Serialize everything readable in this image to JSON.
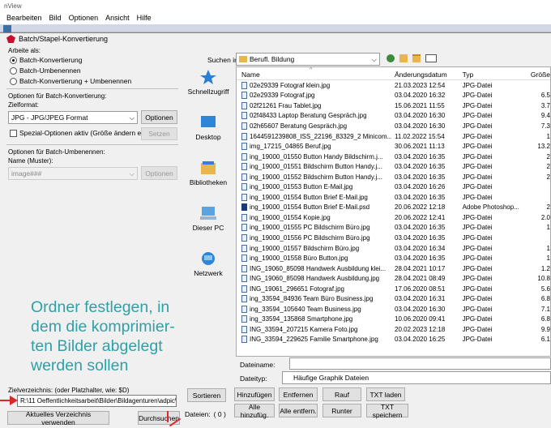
{
  "app": {
    "title": "nView",
    "menu": [
      "Bearbeiten",
      "Bild",
      "Optionen",
      "Ansicht",
      "Hilfe"
    ]
  },
  "dialog": {
    "title": "Batch/Stapel-Konvertierung",
    "mode": {
      "label": "Arbeite als:",
      "options": [
        "Batch-Konvertierung",
        "Batch-Umbenennen",
        "Batch-Konvertierung + Umbenennen"
      ],
      "selected": "Batch-Konvertierung"
    },
    "convert_options": {
      "label": "Optionen für Batch-Konvertierung:",
      "format_label": "Zielformat:",
      "format_value": "JPG - JPG/JPEG Format",
      "options_button": "Optionen",
      "special_checkbox": "Spezial-Optionen aktiv (Größe ändern etc.)",
      "set_button": "Setzen"
    },
    "rename_options": {
      "label": "Optionen für Batch-Umbenennen:",
      "name_label": "Name (Muster):",
      "name_value": "image###",
      "options_button": "Optionen"
    },
    "target": {
      "label": "Zielverzeichnis: (oder Platzhalter, wie: $D)",
      "path": "R:\\11 Oeffentlichkeitsarbeit\\Bilder\\Bildagenturen\\adpic\\Ben...",
      "use_current_button": "Aktuelles Verzeichnis verwenden",
      "browse_button": "Durchsuchen"
    },
    "browser": {
      "search_label": "Suchen in:",
      "folder": "Berufl. Bildung",
      "places": [
        "Schnellzugriff",
        "Desktop",
        "Bibliotheken",
        "Dieser PC",
        "Netzwerk"
      ],
      "columns": [
        "Name",
        "Änderungsdatum",
        "Typ",
        "Größe"
      ],
      "files": [
        {
          "name": "02e29339 Fotograf klein.jpg",
          "date": "21.03.2023 12:54",
          "type": "JPG-Datei",
          "size": ""
        },
        {
          "name": "02e29339 Fotograf.jpg",
          "date": "03.04.2020 16:32",
          "type": "JPG-Datei",
          "size": "6.5"
        },
        {
          "name": "02f21261 Frau Tablet.jpg",
          "date": "15.06.2021 11:55",
          "type": "JPG-Datei",
          "size": "3.7"
        },
        {
          "name": "02f48433 Laptop Beratung Gespräch.jpg",
          "date": "03.04.2020 16:30",
          "type": "JPG-Datei",
          "size": "9.4"
        },
        {
          "name": "02h65607 Beratung Gespräch.jpg",
          "date": "03.04.2020 16:30",
          "type": "JPG-Datei",
          "size": "7.3"
        },
        {
          "name": "1644591239808_ISS_22196_83329_2 Minicom...",
          "date": "11.02.2022 15:54",
          "type": "JPG-Datei",
          "size": "1"
        },
        {
          "name": "img_17215_04865 Beruf.jpg",
          "date": "30.06.2021 11:13",
          "type": "JPG-Datei",
          "size": "13.2"
        },
        {
          "name": "ing_19000_01550 Button Handy Bildschirm.j...",
          "date": "03.04.2020 16:35",
          "type": "JPG-Datei",
          "size": "2"
        },
        {
          "name": "ing_19000_01551 Bildschirm Button Handy.j...",
          "date": "03.04.2020 16:35",
          "type": "JPG-Datei",
          "size": "2"
        },
        {
          "name": "ing_19000_01552 Bildschirm Button Handy.j...",
          "date": "03.04.2020 16:35",
          "type": "JPG-Datei",
          "size": "2"
        },
        {
          "name": "ing_19000_01553 Button E-Mail.jpg",
          "date": "03.04.2020 16:26",
          "type": "JPG-Datei",
          "size": ""
        },
        {
          "name": "ing_19000_01554 Button Brief E-Mail.jpg",
          "date": "03.04.2020 16:35",
          "type": "JPG-Datei",
          "size": ""
        },
        {
          "name": "ing_19000_01554 Button Brief E-Mail.psd",
          "date": "20.06.2022 12:18",
          "type": "Adobe Photoshop...",
          "size": "2",
          "psd": true
        },
        {
          "name": "ing_19000_01554 Kopie.jpg",
          "date": "20.06.2022 12:41",
          "type": "JPG-Datei",
          "size": "2.0"
        },
        {
          "name": "ing_19000_01555 PC Bildschirm Büro.jpg",
          "date": "03.04.2020 16:35",
          "type": "JPG-Datei",
          "size": "1"
        },
        {
          "name": "ing_19000_01556 PC Bildschirm Büro.jpg",
          "date": "03.04.2020 16:35",
          "type": "JPG-Datei",
          "size": ""
        },
        {
          "name": "ing_19000_01557 Bildschirm Büro.jpg",
          "date": "03.04.2020 16:34",
          "type": "JPG-Datei",
          "size": "1"
        },
        {
          "name": "ing_19000_01558 Büro Button.jpg",
          "date": "03.04.2020 16:35",
          "type": "JPG-Datei",
          "size": "1"
        },
        {
          "name": "ING_19060_85098 Handwerk Ausbildung klei...",
          "date": "28.04.2021 10:17",
          "type": "JPG-Datei",
          "size": "1.2"
        },
        {
          "name": "ING_19060_85098 Handwerk Ausbildung.jpg",
          "date": "28.04.2021 08:49",
          "type": "JPG-Datei",
          "size": "10.8"
        },
        {
          "name": "ING_19061_296651 Fotograf.jpg",
          "date": "17.06.2020 08:51",
          "type": "JPG-Datei",
          "size": "5.6"
        },
        {
          "name": "ing_33594_84936 Team Büro Business.jpg",
          "date": "03.04.2020 16:31",
          "type": "JPG-Datei",
          "size": "6.8"
        },
        {
          "name": "ing_33594_105640 Team Business.jpg",
          "date": "03.04.2020 16:30",
          "type": "JPG-Datei",
          "size": "7.1"
        },
        {
          "name": "ing_33594_135868 Smartphone.jpg",
          "date": "10.06.2020 09:41",
          "type": "JPG-Datei",
          "size": "6.8"
        },
        {
          "name": "ING_33594_207215 Kamera Foto.jpg",
          "date": "20.02.2023 12:18",
          "type": "JPG-Datei",
          "size": "9.9"
        },
        {
          "name": "ING_33594_229625 Familie Smartphone.jpg",
          "date": "03.04.2020 16:25",
          "type": "JPG-Datei",
          "size": "6.1"
        }
      ],
      "filename_label": "Dateiname:",
      "filename_value": "",
      "filetype_label": "Dateityp:",
      "filetype_value": "Häufige Graphik Dateien"
    },
    "actions": {
      "sort": "Sortieren",
      "add": "Hinzufügen",
      "remove": "Entfernen",
      "up": "Rauf",
      "txt_load": "TXT laden",
      "add_all": "Alle hinzufüg.",
      "remove_all": "Alle entfern.",
      "down": "Runter",
      "txt_save": "TXT speichern",
      "files_label": "Dateien:",
      "files_count": "( 0 )"
    }
  },
  "annotation": {
    "text": "Ordner festlegen, in dem die komprimier-ten Bilder abgelegt werden sollen",
    "lines": [
      "Ordner festlegen, in",
      "dem die komprimier-",
      "ten Bilder abgelegt",
      "werden sollen"
    ],
    "color": "#2ea1a8",
    "arrow_color": "#e0262d"
  }
}
